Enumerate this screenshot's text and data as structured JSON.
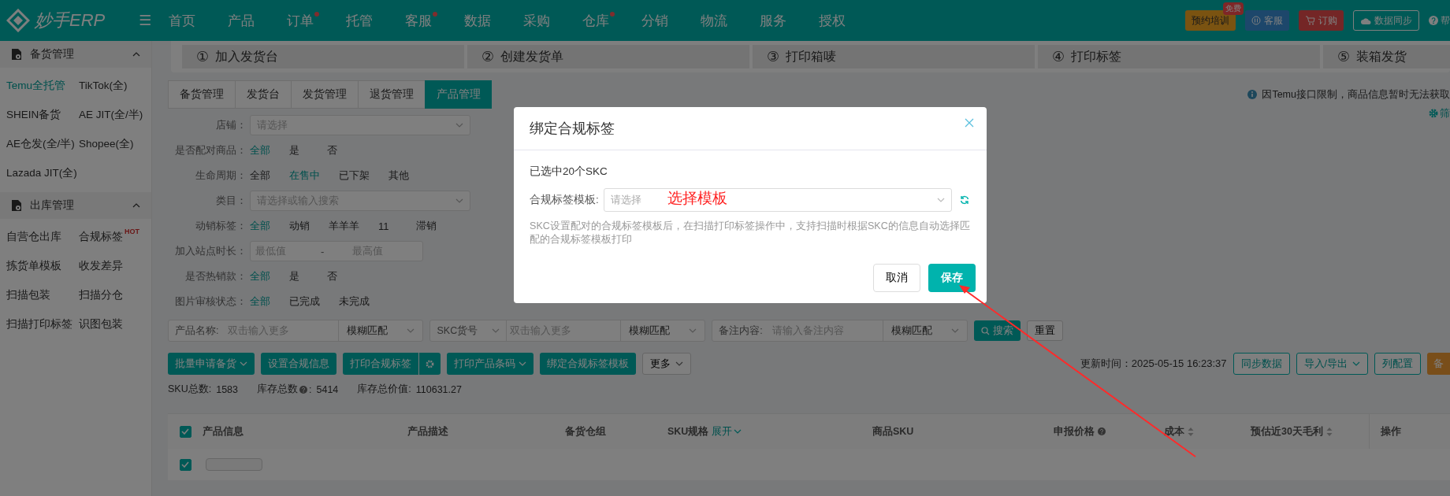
{
  "header": {
    "logo": "妙手ERP",
    "menu_icon": "☰",
    "nav": [
      {
        "label": "首页"
      },
      {
        "label": "产品"
      },
      {
        "label": "订单",
        "dot": true
      },
      {
        "label": "托管"
      },
      {
        "label": "客服",
        "dot": true
      },
      {
        "label": "数据"
      },
      {
        "label": "采购"
      },
      {
        "label": "仓库",
        "dot": true
      },
      {
        "label": "分销"
      },
      {
        "label": "物流"
      },
      {
        "label": "服务"
      },
      {
        "label": "授权"
      }
    ],
    "actions": [
      {
        "kind": "training",
        "label": "预约培训",
        "badge": "免费"
      },
      {
        "kind": "service",
        "label": "客服"
      },
      {
        "kind": "order",
        "label": "订购"
      },
      {
        "kind": "sync",
        "label": "数据同步"
      },
      {
        "kind": "help",
        "label": "帮"
      }
    ]
  },
  "sidebar": {
    "sections": [
      {
        "title": "备货管理",
        "expanded": true,
        "items": [
          {
            "label": "Temu全托管",
            "selected": true
          },
          {
            "label": "TikTok(全)",
            "selected": false
          },
          {
            "label": "SHEIN备货",
            "selected": false
          },
          {
            "label": "AE JIT(全/半)",
            "selected": false
          },
          {
            "label": "AE仓发(全/半)",
            "selected": false
          },
          {
            "label": "Shopee(全)",
            "selected": false
          },
          {
            "label": "Lazada JIT(全)",
            "selected": false
          }
        ]
      },
      {
        "title": "出库管理",
        "expanded": true,
        "items": [
          {
            "label": "自营仓出库",
            "selected": false
          },
          {
            "label": "合规标签",
            "selected": false,
            "badge": "HOT"
          },
          {
            "label": "拣货单模板",
            "selected": false
          },
          {
            "label": "收发差异",
            "selected": false
          },
          {
            "label": "扫描包装",
            "selected": false
          },
          {
            "label": "扫描分仓",
            "selected": false
          },
          {
            "label": "扫描打印标签",
            "selected": false
          },
          {
            "label": "识图包装",
            "selected": false
          }
        ]
      }
    ]
  },
  "steps": [
    {
      "number": "①",
      "label": "加入发货台"
    },
    {
      "number": "②",
      "label": "创建发货单"
    },
    {
      "number": "③",
      "label": "打印箱唛"
    },
    {
      "number": "④",
      "label": "打印标签"
    },
    {
      "number": "⑤",
      "label": "装箱发货"
    }
  ],
  "tabs": [
    {
      "label": "备货管理",
      "selected": false
    },
    {
      "label": "发货台",
      "selected": false
    },
    {
      "label": "发货管理",
      "selected": false
    },
    {
      "label": "退货管理",
      "selected": false
    },
    {
      "label": "产品管理",
      "selected": true
    }
  ],
  "notice": "因Temu接口限制，商品信息暂时无法获取",
  "filter_settings": "筛",
  "filters": [
    {
      "kind": "select",
      "label": "店铺：",
      "placeholder": "请选择"
    },
    {
      "kind": "options",
      "label": "是否配对商品：",
      "options": [
        {
          "label": "全部",
          "selected": true
        },
        {
          "label": "是",
          "selected": false
        },
        {
          "label": "否",
          "selected": false
        }
      ]
    },
    {
      "kind": "options",
      "label": "生命周期：",
      "options": [
        {
          "label": "全部",
          "selected": false
        },
        {
          "label": "在售中",
          "selected": true
        },
        {
          "label": "已下架",
          "selected": false
        },
        {
          "label": "其他",
          "selected": false
        }
      ]
    },
    {
      "kind": "select",
      "label": "类目：",
      "placeholder": "请选择或输入搜索"
    },
    {
      "kind": "options",
      "label": "动销标签：",
      "options": [
        {
          "label": "全部",
          "selected": true
        },
        {
          "label": "动销",
          "selected": false
        },
        {
          "label": "羊羊羊",
          "selected": false
        },
        {
          "label": "11",
          "selected": false
        },
        {
          "label": "滞销",
          "selected": false
        }
      ]
    },
    {
      "kind": "range",
      "label": "加入站点时长：",
      "placeholder": "最低值",
      "separator": "-",
      "placeholder_2": "最高值"
    },
    {
      "kind": "options",
      "label": "是否热销款：",
      "options": [
        {
          "label": "全部",
          "selected": true
        },
        {
          "label": "是",
          "selected": false
        },
        {
          "label": "否",
          "selected": false
        }
      ]
    },
    {
      "kind": "options",
      "label": "图片审核状态：",
      "options": [
        {
          "label": "全部",
          "selected": true
        },
        {
          "label": "已完成",
          "selected": false
        },
        {
          "label": "未完成",
          "selected": false
        }
      ]
    }
  ],
  "search_bar": {
    "groups": [
      {
        "kind": "label",
        "label": "产品名称:",
        "placeholder": "双击输入更多",
        "match": "模糊匹配"
      },
      {
        "kind": "select",
        "label": "SKC货号",
        "placeholder": "双击输入更多",
        "match": "模糊匹配"
      },
      {
        "kind": "label",
        "label": "备注内容:",
        "placeholder": "请输入备注内容",
        "match": "模糊匹配"
      }
    ],
    "search": "搜索",
    "reset": "重置"
  },
  "toolbar": {
    "buttons": [
      {
        "kind": "dropdown",
        "label": "批量申请备货"
      },
      {
        "kind": "plain",
        "label": "设置合规信息"
      },
      {
        "kind": "split",
        "label": "打印合规标签"
      },
      {
        "kind": "dropdown",
        "label": "打印产品条码"
      },
      {
        "kind": "plain",
        "label": "绑定合规标签模板"
      },
      {
        "kind": "more",
        "label": "更多"
      }
    ],
    "updated": "更新时间：2025-05-15 16:23:37",
    "right_buttons": [
      {
        "kind": "outline",
        "label": "同步数据"
      },
      {
        "kind": "outline-dropdown",
        "label": "导入/导出"
      },
      {
        "kind": "outline",
        "label": "列配置"
      },
      {
        "kind": "orange",
        "label": "备"
      }
    ]
  },
  "stats": [
    {
      "label": "SKU总数:",
      "value": "1583"
    },
    {
      "label": "库存总数",
      "help": true,
      "suffix": ":",
      "value": "5414"
    },
    {
      "label": "库存总价值:",
      "value": "110631.27"
    }
  ],
  "table": {
    "all_checked": true,
    "columns": [
      {
        "label": "产品信息"
      },
      {
        "label": "产品描述"
      },
      {
        "label": "备货仓组"
      },
      {
        "label": "SKU规格",
        "extra": "展开"
      },
      {
        "label": "商品SKU"
      },
      {
        "label": "申报价格",
        "help": true
      },
      {
        "label": "成本",
        "sort": true
      },
      {
        "label": "预估近30天毛利",
        "sort": true
      },
      {
        "label": "操作"
      }
    ],
    "rows": [
      {
        "checked": true
      }
    ]
  },
  "dialog": {
    "title": "绑定合规标签",
    "selected_count": "已选中20个SKC",
    "field_label": "合规标签模板:",
    "placeholder": "请选择",
    "annotation": "选择模板",
    "hint": "SKC设置配对的合规标签模板后，在扫描打印标签操作中，支持扫描时根据SKC的信息自动选择匹配的合规标签模板打印",
    "cancel": "取消",
    "save": "保存"
  }
}
